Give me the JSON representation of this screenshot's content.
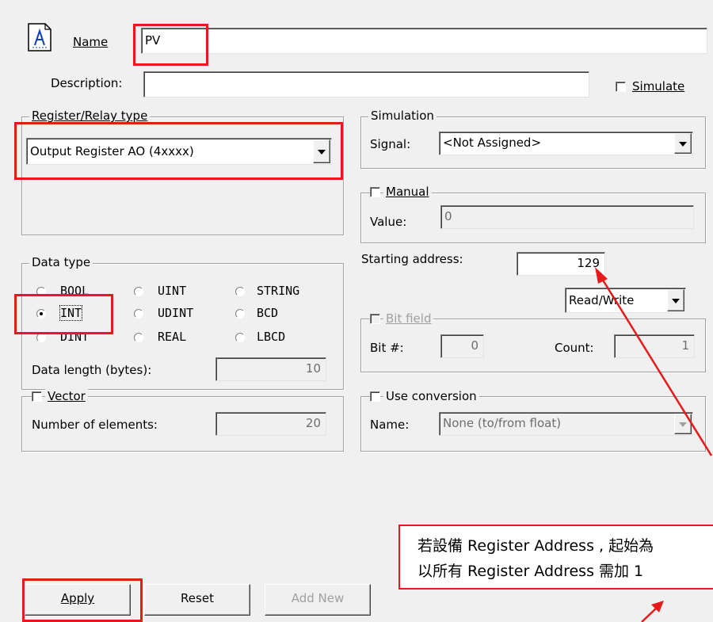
{
  "name": {
    "label": "Name",
    "value": "PV"
  },
  "description": {
    "label": "Description:",
    "value": ""
  },
  "simulate": {
    "label": "Simulate",
    "checked": false
  },
  "register_relay_type": {
    "title": "Register/Relay type",
    "selected": "Output Register AO (4xxxx)"
  },
  "simulation": {
    "title": "Simulation",
    "signal_label": "Signal:",
    "signal_value": "<Not Assigned>"
  },
  "manual": {
    "label": "Manual",
    "checked": false,
    "value_label": "Value:",
    "value": "0"
  },
  "data_type": {
    "title": "Data type",
    "options": [
      "BOOL",
      "UINT",
      "STRING",
      "INT",
      "UDINT",
      "BCD",
      "DINT",
      "REAL",
      "LBCD"
    ],
    "selected": "INT",
    "length_label": "Data length (bytes):",
    "length_value": "10"
  },
  "vector": {
    "label": "Vector",
    "checked": false,
    "elements_label": "Number of elements:",
    "elements_value": "20"
  },
  "starting_address": {
    "label": "Starting address:",
    "value": "129"
  },
  "access": {
    "selected": "Read/Write"
  },
  "bit_field": {
    "label": "Bit field",
    "checked": false,
    "bit_label": "Bit #:",
    "bit_value": "0",
    "count_label": "Count:",
    "count_value": "1"
  },
  "use_conversion": {
    "label": "Use conversion",
    "checked": false,
    "name_label": "Name:",
    "name_value": "None (to/from float)"
  },
  "buttons": {
    "apply": "Apply",
    "reset": "Reset",
    "add_new": "Add New"
  },
  "callout": {
    "line1": "若設備 Register Address , 起始為",
    "line2": "以所有 Register Address 需加 1"
  },
  "annotation_color": "#e51a1a"
}
